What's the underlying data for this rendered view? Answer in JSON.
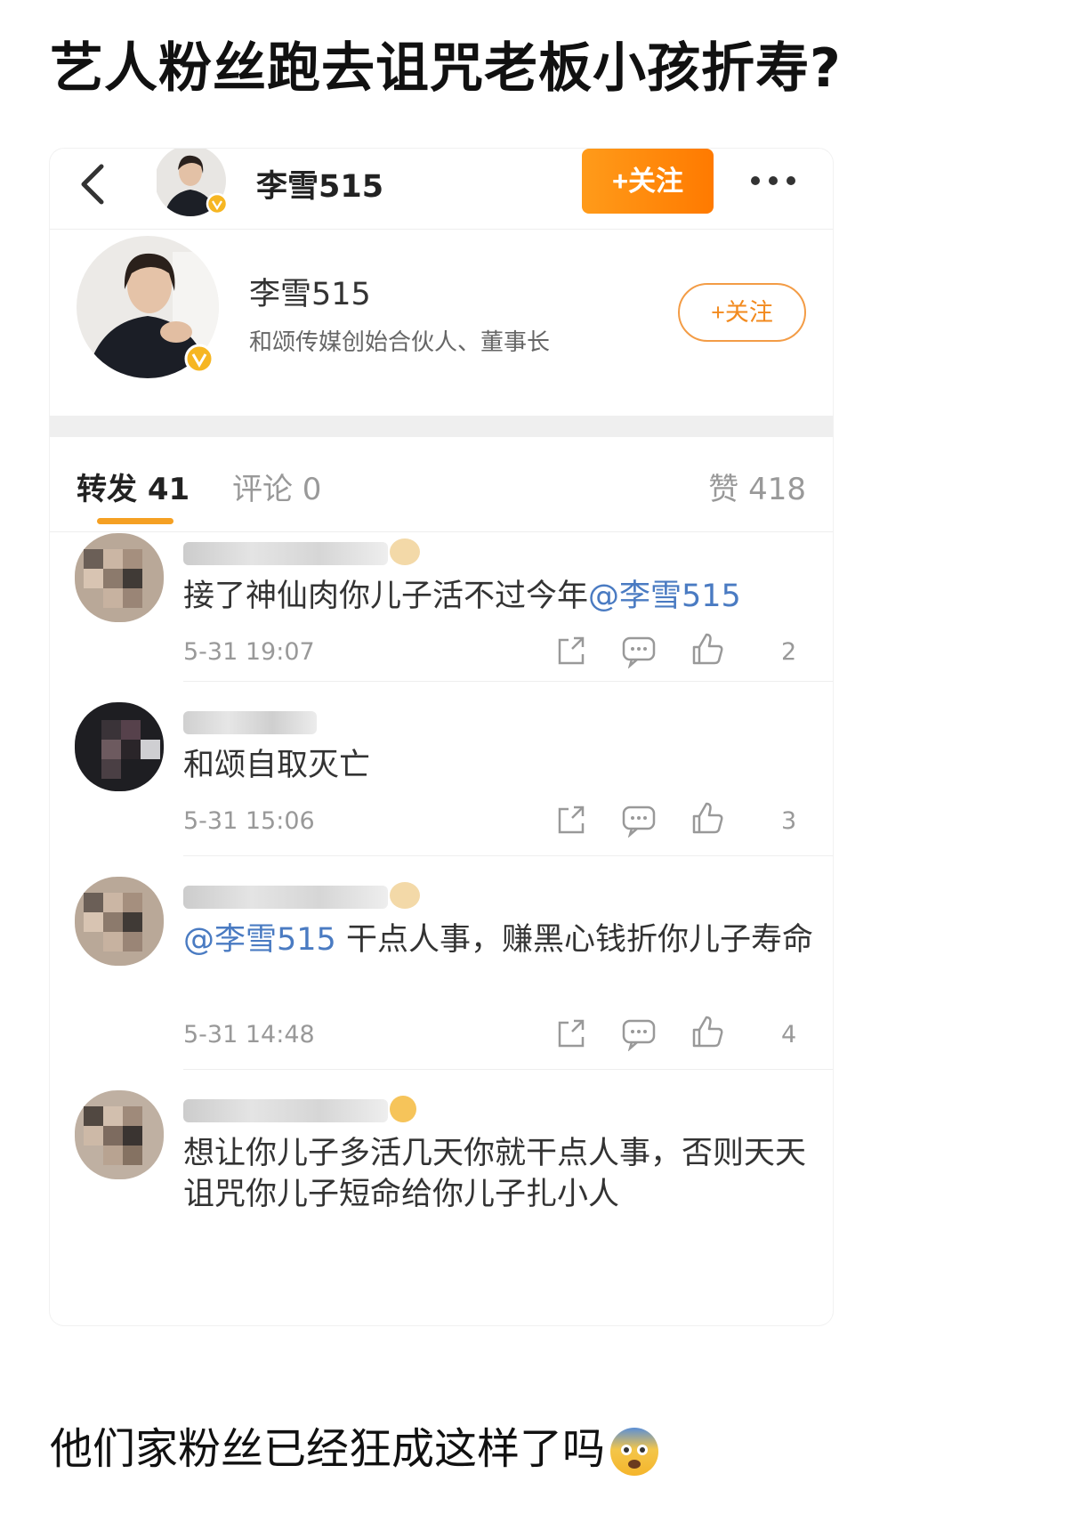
{
  "post": {
    "title": "艺人粉丝跑去诅咒老板小孩折寿?",
    "footer": "他们家粉丝已经狂成这样了吗"
  },
  "topbar": {
    "name": "李雪515",
    "follow_label": "+关注"
  },
  "profile": {
    "name": "李雪515",
    "description": "和颂传媒创始合伙人、董事长",
    "follow_label": "+关注"
  },
  "tabs": {
    "repost": "转发 41",
    "comments": "评论 0",
    "likes": "赞 418"
  },
  "comments": [
    {
      "text_plain": "接了神仙肉你儿子活不过今年",
      "mention": "@李雪515",
      "time": "5-31 19:07",
      "likes": "2"
    },
    {
      "text_plain": "和颂自取灭亡",
      "time": "5-31 15:06",
      "likes": "3"
    },
    {
      "mention": "@李雪515",
      "text_plain": " 干点人事，赚黑心钱折你儿子寿命",
      "time": "5-31 14:48",
      "likes": "4"
    },
    {
      "text_plain": "想让你儿子多活几天你就干点人事，否则天天诅咒你儿子短命给你儿子扎小人"
    }
  ],
  "colors": {
    "accent_orange": "#ff8a00",
    "mention_blue": "#4a7bc2",
    "tab_underline": "#f5a023"
  },
  "icons": [
    "back-icon",
    "more-icon",
    "verified-badge-icon",
    "share-icon",
    "comment-icon",
    "like-icon",
    "fear-emoji-icon"
  ]
}
